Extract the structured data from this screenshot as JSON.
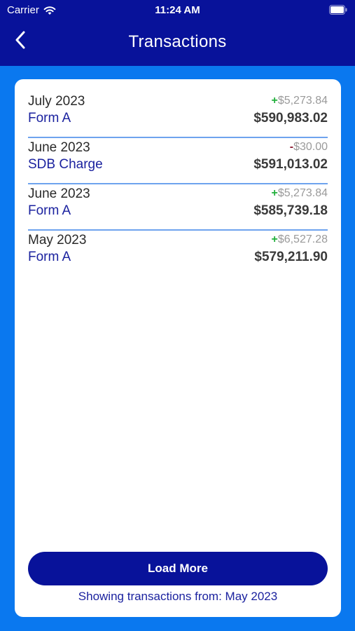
{
  "status_bar": {
    "carrier": "Carrier",
    "time": "11:24 AM",
    "wifi_icon": "wifi-icon",
    "battery_icon": "battery-icon"
  },
  "nav": {
    "title": "Transactions",
    "back_icon": "chevron-left-icon"
  },
  "transactions": [
    {
      "date": "July 2023",
      "type": "Form  A",
      "sign": "+",
      "change": "$5,273.84",
      "balance": "$590,983.02"
    },
    {
      "date": "June 2023",
      "type": "SDB Charge",
      "sign": "-",
      "change": "$30.00",
      "balance": "$591,013.02"
    },
    {
      "date": "June 2023",
      "type": "Form  A",
      "sign": "+",
      "change": "$5,273.84",
      "balance": "$585,739.18"
    },
    {
      "date": "May 2023",
      "type": "Form  A",
      "sign": "+",
      "change": "$6,527.28",
      "balance": "$579,211.90"
    }
  ],
  "footer": {
    "load_more_label": "Load More",
    "showing_text": "Showing transactions from: May 2023"
  },
  "colors": {
    "header_bg": "#08129a",
    "page_bg": "#0a78ef",
    "accent_text": "#1b229f",
    "positive": "#22b03c",
    "negative": "#8c1b33",
    "divider": "#6ea3ee"
  }
}
